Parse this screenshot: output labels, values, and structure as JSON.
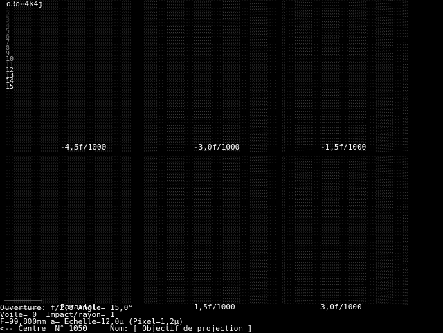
{
  "title": "o3o-4k4j",
  "levels": [
    "1",
    "2",
    "3",
    "4",
    "5",
    "6",
    "7",
    "8",
    "9",
    "10",
    "11",
    "12",
    "13",
    "14",
    "15"
  ],
  "level_colors": [
    "#1a1a1a",
    "#2a2a2a",
    "#3a3a3a",
    "#4a4a4a",
    "#5a5a5a",
    "#6a6a6a",
    "#7a7a7a",
    "#8a8a8a",
    "#9a9a9a",
    "#bbbbbb",
    "#cccccc",
    "#dddddd",
    "#eeeeee",
    "#f4f4f4",
    "#ffffff"
  ],
  "panels": [
    {
      "label": "-4,5f/1000"
    },
    {
      "label": "-3,0f/1000"
    },
    {
      "label": "-1,5f/1000"
    },
    {
      "label": "Paraxial"
    },
    {
      "label": "1,5f/1000"
    },
    {
      "label": "3,0f/1000"
    }
  ],
  "status": {
    "line1": "Ouverture: f/2,8 Angle= 15,0°",
    "line2": "Voile= 0  Impact/rayon= 1",
    "line3": "F=99,800mm a= Echelle=12,0µ (Pixel=1,2µ)",
    "line4": "<-- Centre  N° 1050     Nom: [ Objectif de projection ]"
  }
}
